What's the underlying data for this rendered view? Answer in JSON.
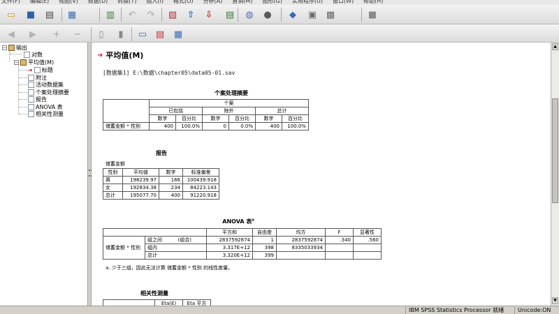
{
  "menu": [
    "文件(F)",
    "编辑(E)",
    "视图(V)",
    "数据(D)",
    "转换(T)",
    "插入(I)",
    "格式(O)",
    "分析(A)",
    "直销(M)",
    "图形(G)",
    "实用程序(U)",
    "窗口(W)",
    "帮助(H)"
  ],
  "toolbar1": [
    {
      "name": "open-icon",
      "glyph": "▭",
      "color": "#c79c2a"
    },
    {
      "name": "save-icon",
      "glyph": "■",
      "color": "#2f5fa8"
    },
    {
      "name": "print-icon",
      "glyph": "▤",
      "color": "#4a4a4a"
    },
    {
      "name": "export-icon",
      "glyph": "▦",
      "color": "#3d6fb0"
    },
    {
      "name": "dialog-recall-icon",
      "glyph": "▥",
      "color": "#3d7f3d"
    },
    {
      "name": "undo-icon",
      "glyph": "↶",
      "color": "#7a7a7a"
    },
    {
      "name": "redo-icon",
      "glyph": "↷",
      "color": "#7a7a7a"
    },
    {
      "name": "goto-data-icon",
      "glyph": "▧",
      "color": "#b03030"
    },
    {
      "name": "goto-case-icon",
      "glyph": "⇧",
      "color": "#3a6ab8"
    },
    {
      "name": "goto-variable-icon",
      "glyph": "⇩",
      "color": "#c03030"
    },
    {
      "name": "variables-icon",
      "glyph": "▤",
      "color": "#3a7a3a"
    },
    {
      "name": "use-sets-icon",
      "glyph": "◍",
      "color": "#4f70b0"
    },
    {
      "name": "show-all-variables-icon",
      "glyph": "●",
      "color": "#5a5a5a"
    },
    {
      "name": "designate-window-icon",
      "glyph": "◆",
      "color": "#3a6ab8"
    },
    {
      "name": "split-file-icon",
      "glyph": "▣",
      "color": "#6a6a6a"
    },
    {
      "name": "select-cases-icon",
      "glyph": "▩",
      "color": "#6a6a6a"
    },
    {
      "name": "weight-cases-icon",
      "glyph": "■",
      "color": "#8a8a8a"
    }
  ],
  "toolbar2": [
    {
      "name": "promote-icon",
      "glyph": "◀",
      "color": "#7a7a7a"
    },
    {
      "name": "demote-icon",
      "glyph": "▶",
      "color": "#7a7a7a"
    },
    {
      "name": "expand-icon",
      "glyph": "+",
      "color": "#7a7a7a"
    },
    {
      "name": "collapse-icon",
      "glyph": "−",
      "color": "#7a7a7a"
    },
    {
      "name": "show-icon",
      "glyph": "▯",
      "color": "#8a8a8a"
    },
    {
      "name": "hide-icon",
      "glyph": "▮",
      "color": "#8a8a8a"
    },
    {
      "name": "insert-heading-icon",
      "glyph": "▭",
      "color": "#3a6ab8"
    },
    {
      "name": "insert-title-icon",
      "glyph": "▤",
      "color": "#c03030"
    },
    {
      "name": "insert-text-icon",
      "glyph": "▦",
      "color": "#3a6ab8"
    }
  ],
  "outline": {
    "root": "输出",
    "log": "对数",
    "means": "平均值(M)",
    "children": [
      "标题",
      "附注",
      "活动数据集",
      "个案处理摘要",
      "报告",
      "ANOVA 表",
      "相关性测量"
    ]
  },
  "content": {
    "procedure_title": "平均值(M)",
    "dataset_line": "[数据集1] E:\\数据\\chapter05\\data05-01.sav",
    "case_summary": {
      "title": "个案处理摘要",
      "group_header": "个案",
      "col_groups": [
        "已包括",
        "除外",
        "总计"
      ],
      "sub_headers": [
        "数字",
        "百分比",
        "数字",
        "百分比",
        "数字",
        "百分比"
      ],
      "row_label": "储蓄金额 * 性别",
      "row_values": [
        "400",
        "100.0%",
        "0",
        "0.0%",
        "400",
        "100.0%"
      ]
    },
    "report": {
      "title": "报告",
      "dep_label": "储蓄金额",
      "headers": [
        "性别",
        "平均值",
        "数字",
        "标准偏差"
      ],
      "rows": [
        [
          "男",
          "198239.97",
          "166",
          "100439.918"
        ],
        [
          "女",
          "192834.38",
          "234",
          "84223.143"
        ],
        [
          "总计",
          "195077.70",
          "400",
          "91220.918"
        ]
      ]
    },
    "anova": {
      "title": "ANOVA 表",
      "title_sup": "a",
      "headers": [
        "平方和",
        "自由度",
        "均方",
        "F",
        "显著性"
      ],
      "row_label": "储蓄金额 * 性别",
      "rows": [
        {
          "label": "组之间",
          "sub": "(组合)",
          "values": [
            "2837592874",
            "1",
            "2837592874",
            ".340",
            ".560"
          ]
        },
        {
          "label": "组内",
          "sub": "",
          "values": [
            "3.317E+12",
            "398",
            "8335033934",
            "",
            ""
          ]
        },
        {
          "label": "总计",
          "sub": "",
          "values": [
            "3.320E+12",
            "399",
            "",
            "",
            ""
          ]
        }
      ],
      "footnote": "a. 少于三组，因此无法计算 储蓄金额 * 性别 的线性度量。"
    },
    "association": {
      "title": "相关性测量",
      "headers": [
        "Eta(E)",
        "Eta 平方"
      ]
    }
  },
  "status": {
    "processor": "IBM SPSS Statistics Processor 就绪",
    "encoding": "Unicode:ON"
  }
}
